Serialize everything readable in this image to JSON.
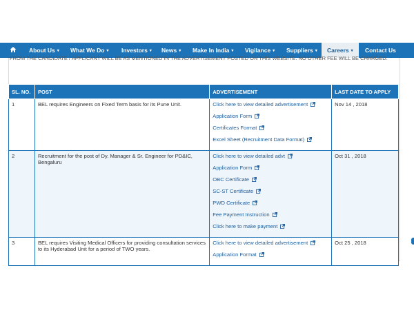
{
  "nav": {
    "home_icon": "home-icon",
    "items": [
      {
        "label": "About Us",
        "has_dropdown": true
      },
      {
        "label": "What We Do",
        "has_dropdown": true
      },
      {
        "label": "Investors",
        "has_dropdown": true
      },
      {
        "label": "News",
        "has_dropdown": true
      },
      {
        "label": "Make In India",
        "has_dropdown": true
      },
      {
        "label": "Vigilance",
        "has_dropdown": true
      },
      {
        "label": "Suppliers",
        "has_dropdown": true
      },
      {
        "label": "Careers",
        "has_dropdown": true,
        "active": true
      },
      {
        "label": "Contact Us",
        "has_dropdown": false
      }
    ],
    "caret": "▾"
  },
  "notice_text": "FROM THE CANDIDATE / APPLICANT WILL BE AS MENTIONED IN THE ADVERTISEMENT POSTED ON THIS WEBSITE. NO OTHER FEE WILL BE CHARGED.",
  "table": {
    "headers": {
      "sl": "SL. NO.",
      "post": "POST",
      "advertisement": "ADVERTISEMENT",
      "last_date": "LAST DATE TO APPLY"
    },
    "rows": [
      {
        "sl": "1",
        "post": "BEL requires Engineers on Fixed Term basis for its Pune Unit.",
        "links": [
          "Click here to view detailed advertisement",
          "Application Form",
          "Certificates Format",
          "Excel Sheet (Recruitment Data Format)"
        ],
        "last_date": "Nov 14 , 2018"
      },
      {
        "sl": "2",
        "post": "Recruitment for the post of Dy. Manager & Sr. Engineer for PD&IC, Bengaluru",
        "links": [
          "Click here to view detailed advt",
          "Application Form",
          "OBC Certificate",
          "SC-ST Certificate",
          "PWD Certificate",
          "Fee Payment Instruction",
          "Click here to make payment"
        ],
        "last_date": "Oct 31 , 2018"
      },
      {
        "sl": "3",
        "post": "BEL requires Visiting Medical Officers for providing consultation services to its Hyderabad Unit for a period of TWO years.",
        "links": [
          "Click here to view detailed advertisement",
          "Application Format"
        ],
        "last_date": "Oct 25 , 2018"
      }
    ]
  },
  "colors": {
    "primary": "#1c73b8",
    "link": "#1f5f9e",
    "row_alt": "#eef5fb",
    "active_tab_bg": "#e9eef3"
  }
}
